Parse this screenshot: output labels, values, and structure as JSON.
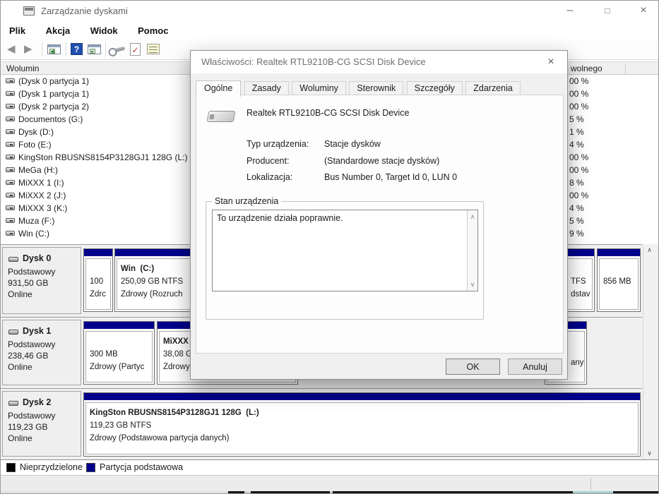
{
  "window": {
    "title": "Zarządzanie dyskami"
  },
  "menu": {
    "items": [
      "Plik",
      "Akcja",
      "Widok",
      "Pomoc"
    ]
  },
  "toolbar": {
    "icons": [
      "back-icon",
      "forward-icon",
      "show-console-tree-icon",
      "help-icon",
      "show-action-pane-icon",
      "tool-icon",
      "check-document-icon",
      "properties-icon"
    ]
  },
  "columns": {
    "volume": "Wolumin",
    "free_percent": "% wolnego"
  },
  "volume_list": {
    "rows": [
      {
        "label": "(Dysk 0 partycja 1)",
        "free_visible": "00 %"
      },
      {
        "label": "(Dysk 1 partycja 1)",
        "free_visible": "00 %"
      },
      {
        "label": "(Dysk 2 partycja 2)",
        "free_visible": "00 %"
      },
      {
        "label": "Documentos (G:)",
        "free_visible": "5 %"
      },
      {
        "label": "Dysk (D:)",
        "free_visible": "1 %"
      },
      {
        "label": "Foto (E:)",
        "free_visible": "4 %"
      },
      {
        "label": "KingSton RBUSNS8154P3128GJ1 128G (L:)",
        "free_visible": "00 %"
      },
      {
        "label": "MeGa (H:)",
        "free_visible": "00 %"
      },
      {
        "label": "MiXXX 1 (I:)",
        "free_visible": "8 %"
      },
      {
        "label": "MiXXX 2 (J:)",
        "free_visible": "00 %"
      },
      {
        "label": "MiXXX 3 (K:)",
        "free_visible": "4 %"
      },
      {
        "label": "Muza (F:)",
        "free_visible": "5 %"
      },
      {
        "label": "Win (C:)",
        "free_visible": "9 %"
      }
    ]
  },
  "disks": [
    {
      "name": "Dysk 0",
      "kind": "Podstawowy",
      "size": "931,50 GB",
      "status": "Online",
      "partitions": [
        {
          "l2": "100",
          "l3": "Zdrc"
        },
        {
          "l1": "Win  (C:)",
          "l2": "250,09 GB NTFS",
          "l3": "Zdrowy (Rozruch"
        },
        {
          "l2": "TFS",
          "l3": "dstav"
        },
        {
          "l2": "856 MB"
        }
      ]
    },
    {
      "name": "Dysk 1",
      "kind": "Podstawowy",
      "size": "238,46 GB",
      "status": "Online",
      "partitions": [
        {
          "l2": "300 MB",
          "l3": "Zdrowy (Partyc"
        },
        {
          "l1": "MiXXX",
          "l2": "38,08 G",
          "l3": "Zdrowy"
        },
        {
          "l3": "any"
        }
      ]
    },
    {
      "name": "Dysk 2",
      "kind": "Podstawowy",
      "size": "119,23 GB",
      "status": "Online",
      "partitions": [
        {
          "l1": "KingSton RBUSNS8154P3128GJ1 128G  (L:)",
          "l2": "119,23 GB NTFS",
          "l3": "Zdrowy (Podstawowa partycja danych)"
        }
      ]
    }
  ],
  "dialog": {
    "title": "Właściwości: Realtek RTL9210B-CG SCSI Disk Device",
    "tabs": [
      "Ogólne",
      "Zasady",
      "Woluminy",
      "Sterownik",
      "Szczegóły",
      "Zdarzenia"
    ],
    "active_tab": "Ogólne",
    "device_name": "Realtek RTL9210B-CG SCSI Disk Device",
    "fields": [
      {
        "label": "Typ urządzenia:",
        "value": "Stacje dysków"
      },
      {
        "label": "Producent:",
        "value": "(Standardowe stacje dysków)"
      },
      {
        "label": "Lokalizacja:",
        "value": "Bus Number 0, Target Id 0, LUN 0"
      }
    ],
    "device_state_title": "Stan urządzenia",
    "device_state_text": "To urządzenie działa poprawnie.",
    "ok_label": "OK",
    "cancel_label": "Anuluj"
  },
  "legend": {
    "items": [
      {
        "label": "Nieprzydzielone",
        "color": "#000000"
      },
      {
        "label": "Partycja podstawowa",
        "color": "#00008B"
      }
    ]
  },
  "colors": {
    "primary_partition": "#00008B",
    "unallocated": "#000000",
    "help_icon_blue": "#1F4FAE"
  }
}
